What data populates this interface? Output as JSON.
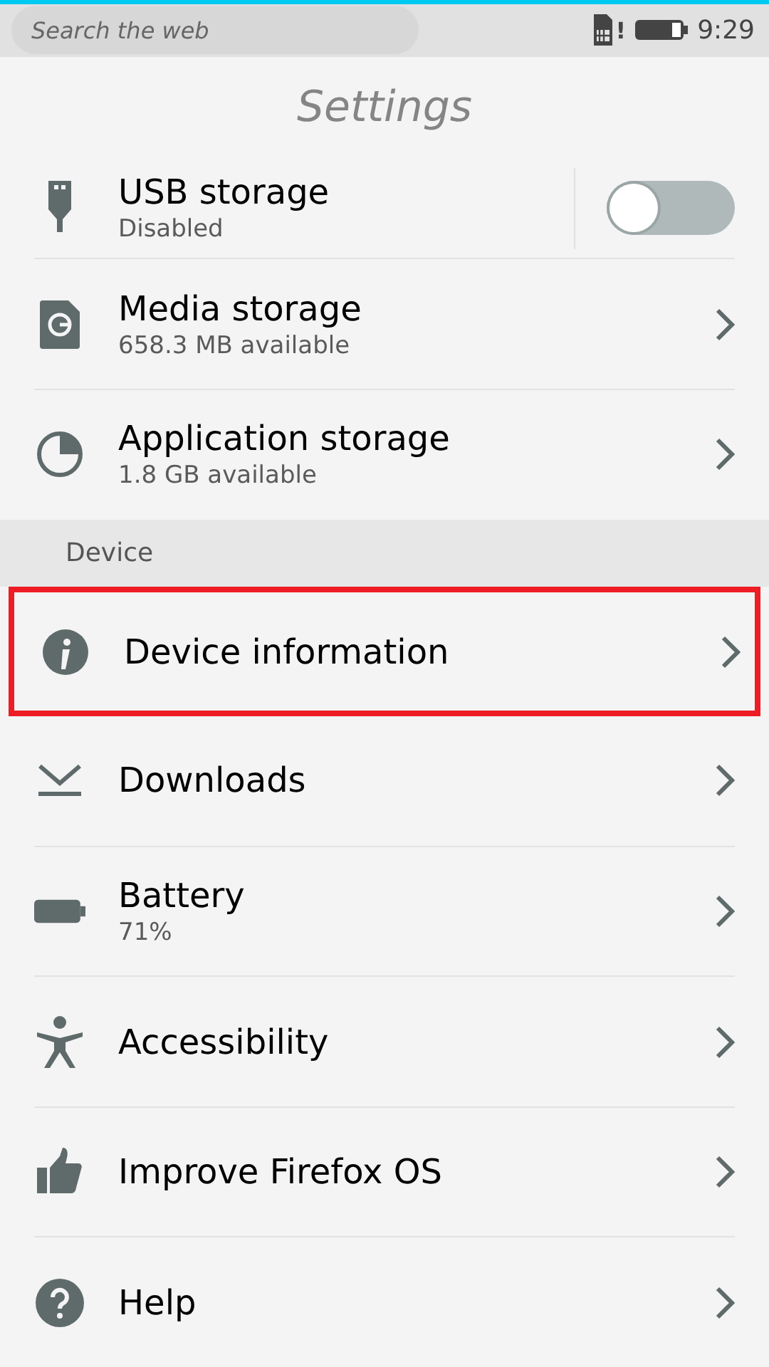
{
  "status_bar": {
    "search": {
      "placeholder": "Search the web"
    },
    "sim_alert": "!",
    "time": "9:29"
  },
  "header": {
    "title": "Settings"
  },
  "sections": [
    {
      "items": [
        {
          "kind": "toggle",
          "title": "USB storage",
          "subtitle": "Disabled",
          "on": false,
          "highlighted": false
        },
        {
          "kind": "link",
          "title": "Media storage",
          "subtitle": "658.3 MB available",
          "highlighted": false
        },
        {
          "kind": "link",
          "title": "Application storage",
          "subtitle": "1.8 GB available",
          "highlighted": false
        }
      ]
    },
    {
      "heading": "Device",
      "items": [
        {
          "kind": "link",
          "title": "Device information",
          "highlighted": true
        },
        {
          "kind": "link",
          "title": "Downloads",
          "highlighted": false
        },
        {
          "kind": "link",
          "title": "Battery",
          "subtitle": "71%",
          "highlighted": false
        },
        {
          "kind": "link",
          "title": "Accessibility",
          "highlighted": false
        },
        {
          "kind": "link",
          "title": "Improve Firefox OS",
          "highlighted": false
        },
        {
          "kind": "link",
          "title": "Help",
          "highlighted": false
        }
      ]
    }
  ]
}
